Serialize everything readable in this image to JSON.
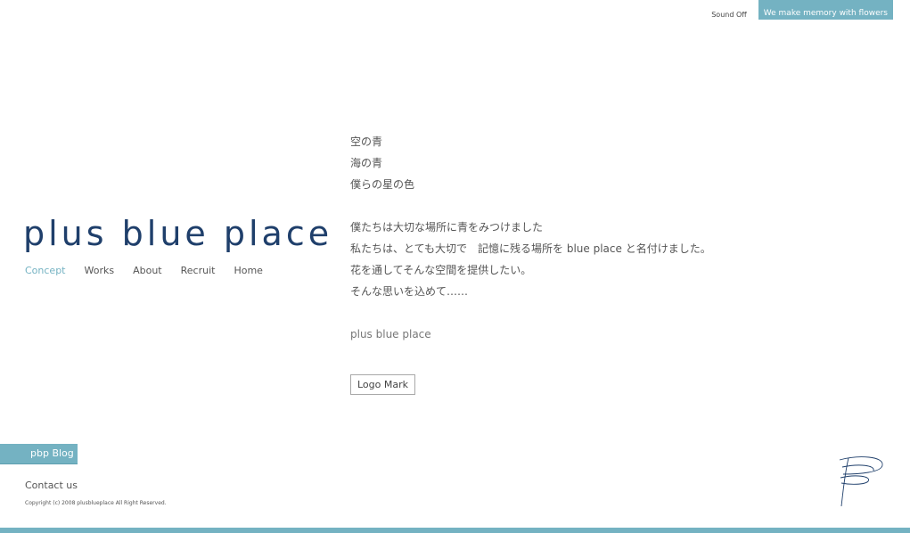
{
  "header": {
    "sound_label": "Sound Off",
    "tagline": "We make memory with flowers"
  },
  "brand": {
    "logo_text": "plus blue place",
    "logo_color": "#1f3f6b",
    "accent_color": "#74b2c2"
  },
  "nav": {
    "items": [
      {
        "label": "Concept",
        "active": true
      },
      {
        "label": "Works"
      },
      {
        "label": "About"
      },
      {
        "label": "Recruit"
      },
      {
        "label": "Home"
      }
    ]
  },
  "main": {
    "lines": [
      "空の青",
      "海の青",
      "僕らの星の色",
      "僕たちは大切な場所に青をみつけました",
      "私たちは、とても大切で　記憶に残る場所を blue place と名付けました。",
      "花を通してそんな空間を提供したい。",
      "そんな思いを込めて……",
      "plus blue place"
    ],
    "logo_mark_label": "Logo Mark"
  },
  "footer": {
    "blog_label": "pbp Blog",
    "contact_label": "Contact us",
    "copyright": "Copyright (c)  2008  plusblueplace  All Right Reserved.",
    "mark_icon": "scribble-p-logo-icon"
  }
}
